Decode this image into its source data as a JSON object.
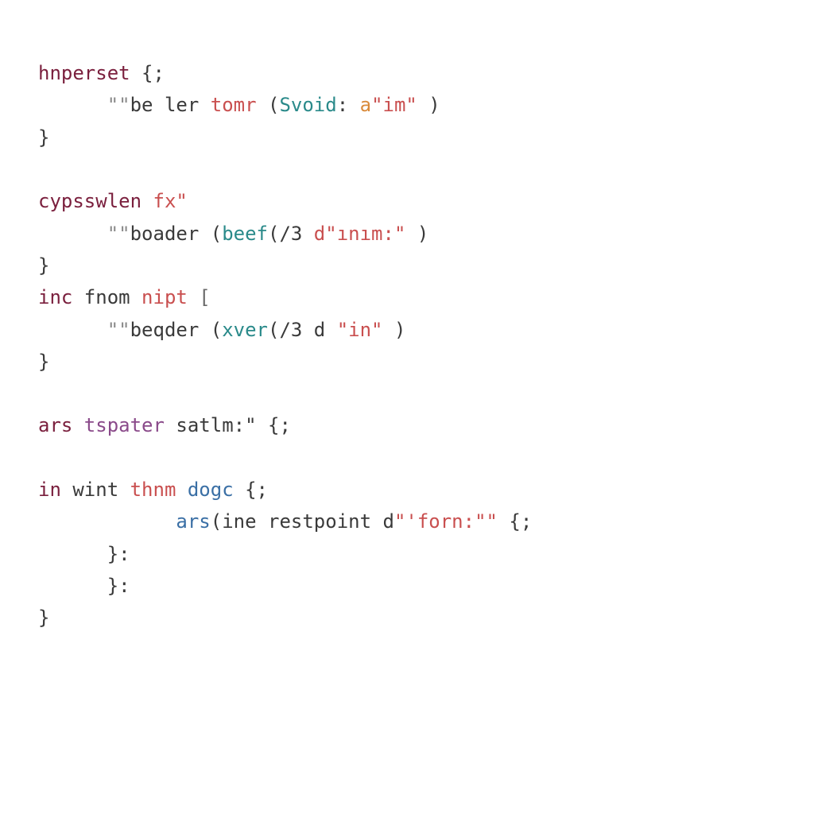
{
  "code": {
    "l01": {
      "a": "hnperset",
      "b": " {;"
    },
    "l02": {
      "a": "      \"\"",
      "b": "be ler",
      "c": " tomr",
      "d": " (",
      "e": "Svoid",
      "f": ": ",
      "g": "a",
      "h": "\"im\"",
      "i": " )"
    },
    "l03": {
      "a": "}"
    },
    "l04": {
      "a": ""
    },
    "l05": {
      "a": "cypsswlen",
      "b": " ",
      "c": "fx\""
    },
    "l06": {
      "a": "      \"\"",
      "b": "boader",
      "c": " (",
      "d": "beef",
      "e": "(/3 ",
      "f": "d",
      "g": "\"ınım:\"",
      "h": " )"
    },
    "l07": {
      "a": "}"
    },
    "l08": {
      "a": "inc",
      "b": " fnom",
      "c": " nipt",
      "d": " ["
    },
    "l09": {
      "a": "      \"\"",
      "b": "beqder",
      "c": " (",
      "d": "xver",
      "e": "(/3 d ",
      "f": "\"in\"",
      "g": " )"
    },
    "l10": {
      "a": "}"
    },
    "l11": {
      "a": ""
    },
    "l12": {
      "a": "ars",
      "b": " tspater",
      "c": " satlm:\"",
      "d": " {;"
    },
    "l13": {
      "a": ""
    },
    "l14": {
      "a": "in",
      "b": " wint",
      "c": " thnm",
      "d": " dogc",
      "e": " {;"
    },
    "l15": {
      "a": "            ",
      "b": "ars",
      "c": "(ine restpoint d",
      "d": "\"'forn:\"\"",
      "e": " {;"
    },
    "l16": {
      "a": "      }:"
    },
    "l17": {
      "a": "      }:"
    },
    "l18": {
      "a": "}"
    }
  }
}
